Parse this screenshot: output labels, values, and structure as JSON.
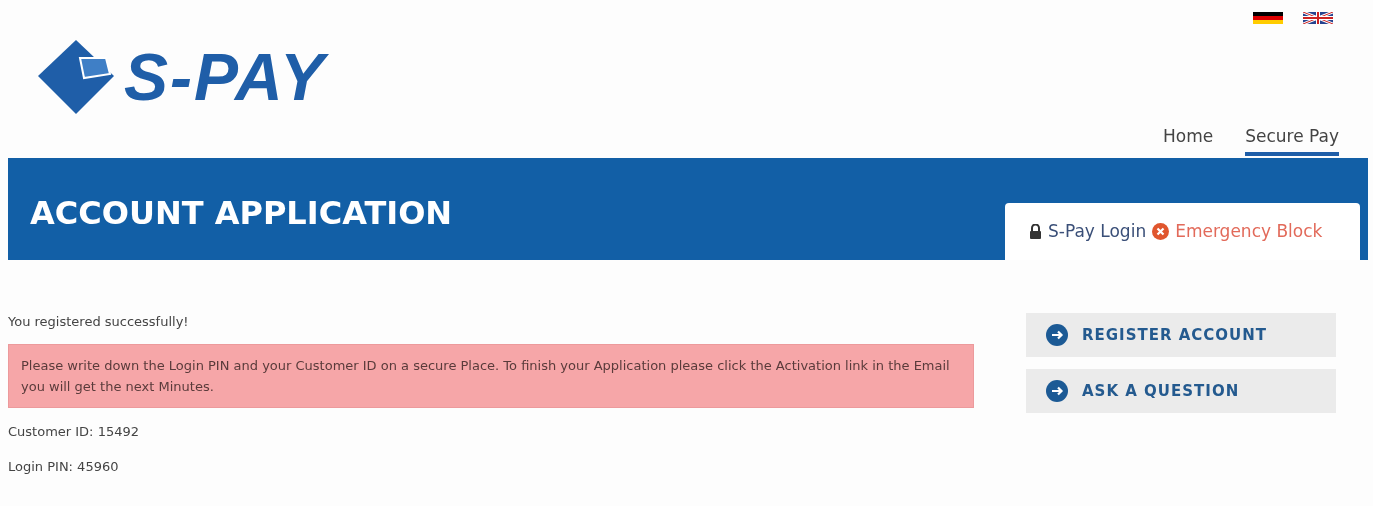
{
  "logo": {
    "text": "S-PAY"
  },
  "languages": [
    {
      "kind": "de"
    },
    {
      "kind": "en"
    }
  ],
  "nav": [
    {
      "label": "Home",
      "selected": false
    },
    {
      "label": "Secure Pay",
      "selected": true
    }
  ],
  "banner": {
    "title": "ACCOUNT APPLICATION"
  },
  "login_tabs": [
    {
      "kind": "lock",
      "label": "S-Pay Login"
    },
    {
      "kind": "block",
      "label": "Emergency Block"
    }
  ],
  "content": {
    "success": "You registered successfully!",
    "alert": "Please write down the Login PIN and your Customer ID on a secure Place. To finish your Application please click the Activation link in the Email you will get the next Minutes.",
    "lines": [
      "Customer ID: 15492",
      "Login PIN: 45960"
    ]
  },
  "side_buttons": [
    "REGISTER ACCOUNT",
    "ASK A QUESTION"
  ]
}
